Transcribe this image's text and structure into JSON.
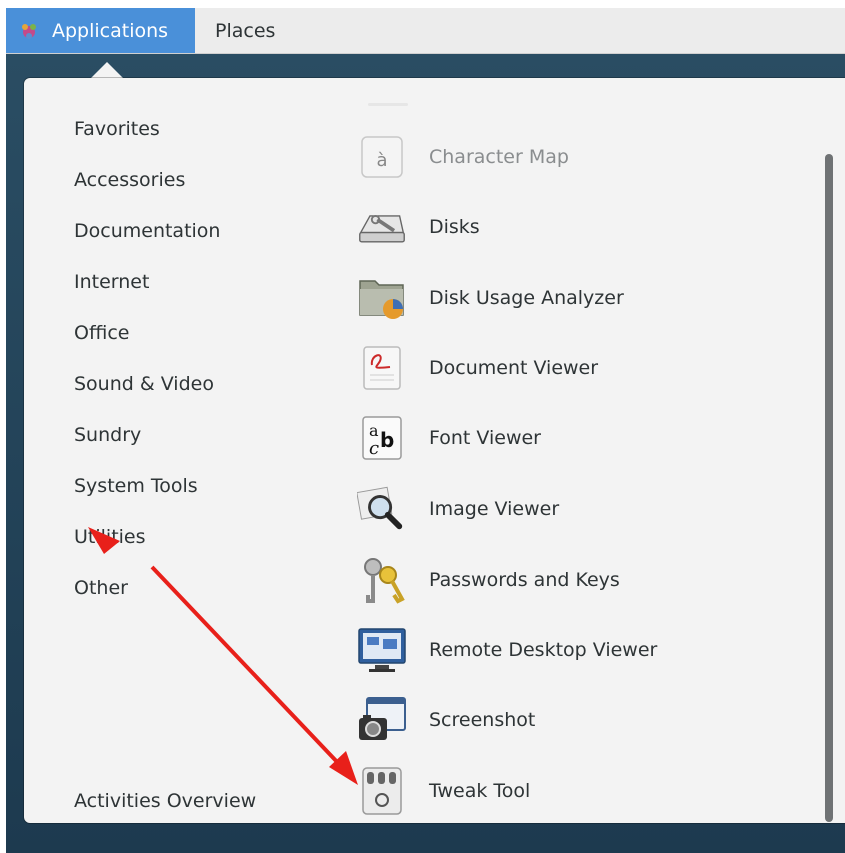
{
  "topbar": {
    "applications_label": "Applications",
    "places_label": "Places"
  },
  "categories": [
    "Favorites",
    "Accessories",
    "Documentation",
    "Internet",
    "Office",
    "Sound & Video",
    "Sundry",
    "System Tools",
    "Utilities",
    "Other"
  ],
  "activities_label": "Activities Overview",
  "apps": [
    {
      "label": "Character Map",
      "icon": "character-map-icon",
      "dimmed": true
    },
    {
      "label": "Disks",
      "icon": "disks-icon"
    },
    {
      "label": "Disk Usage Analyzer",
      "icon": "disk-usage-analyzer-icon"
    },
    {
      "label": "Document Viewer",
      "icon": "document-viewer-icon"
    },
    {
      "label": "Font Viewer",
      "icon": "font-viewer-icon"
    },
    {
      "label": "Image Viewer",
      "icon": "image-viewer-icon"
    },
    {
      "label": "Passwords and Keys",
      "icon": "passwords-and-keys-icon"
    },
    {
      "label": "Remote Desktop Viewer",
      "icon": "remote-desktop-viewer-icon"
    },
    {
      "label": "Screenshot",
      "icon": "screenshot-icon"
    },
    {
      "label": "Tweak Tool",
      "icon": "tweak-tool-icon"
    }
  ],
  "colors": {
    "accent": "#4a90d9",
    "annotation_arrow": "#e8201a"
  }
}
